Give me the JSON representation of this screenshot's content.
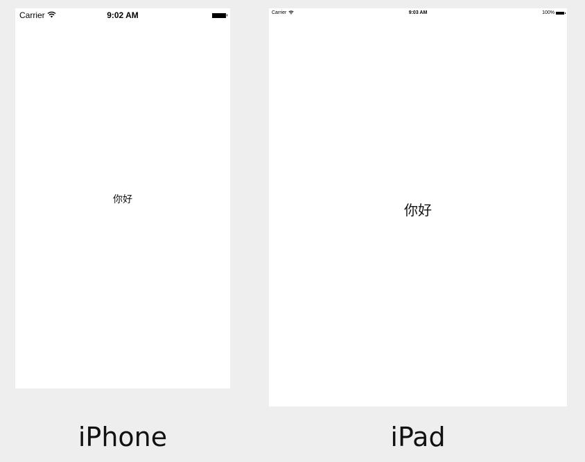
{
  "iphone": {
    "status_bar": {
      "carrier": "Carrier",
      "time": "9:02 AM"
    },
    "content_label": "你好",
    "caption": "iPhone"
  },
  "ipad": {
    "status_bar": {
      "carrier": "Carrier",
      "time": "9:03 AM",
      "battery_percent": "100%"
    },
    "content_label": "你好",
    "caption": "iPad"
  },
  "icons": [
    "wifi-icon",
    "battery-icon"
  ]
}
